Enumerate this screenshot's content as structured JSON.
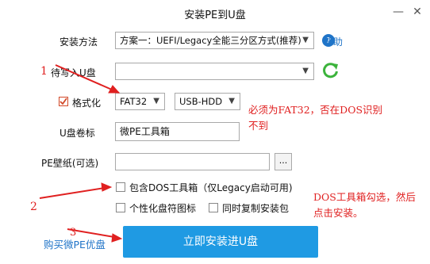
{
  "window": {
    "title": "安装PE到U盘",
    "minimize": "—",
    "close": "✕"
  },
  "install_method": {
    "label": "安装方法",
    "value": "方案一：UEFI/Legacy全能三分区方式(推荐)",
    "help": "帮助"
  },
  "target_disk": {
    "label": "待写入U盘",
    "value": ""
  },
  "format": {
    "label": "格式化",
    "checked": true,
    "fs_value": "FAT32",
    "mode_value": "USB-HDD"
  },
  "volume_label": {
    "label": "U盘卷标",
    "value": "微PE工具箱"
  },
  "wallpaper": {
    "label": "PE壁纸(可选)",
    "value": "",
    "browse": "..."
  },
  "options": {
    "dos_tools": "包含DOS工具箱（仅Legacy启动可用)",
    "custom_icon": "个性化盘符图标",
    "copy_installer": "同时复制安装包"
  },
  "footer": {
    "buy_link": "购买微PE优盘",
    "install_button": "立即安装进U盘"
  },
  "annotations": {
    "num1": "1",
    "num2": "2",
    "num3": "3",
    "note1_line1": "必须为FAT32，否在DOS识别",
    "note1_line2": "不到",
    "note2_line1": "DOS工具箱勾选，然后",
    "note2_line2": "点击安装。"
  },
  "colors": {
    "accent": "#1f9ae3",
    "link": "#1f74c8",
    "annotation": "#e02020",
    "refresh": "#3bb33b"
  }
}
